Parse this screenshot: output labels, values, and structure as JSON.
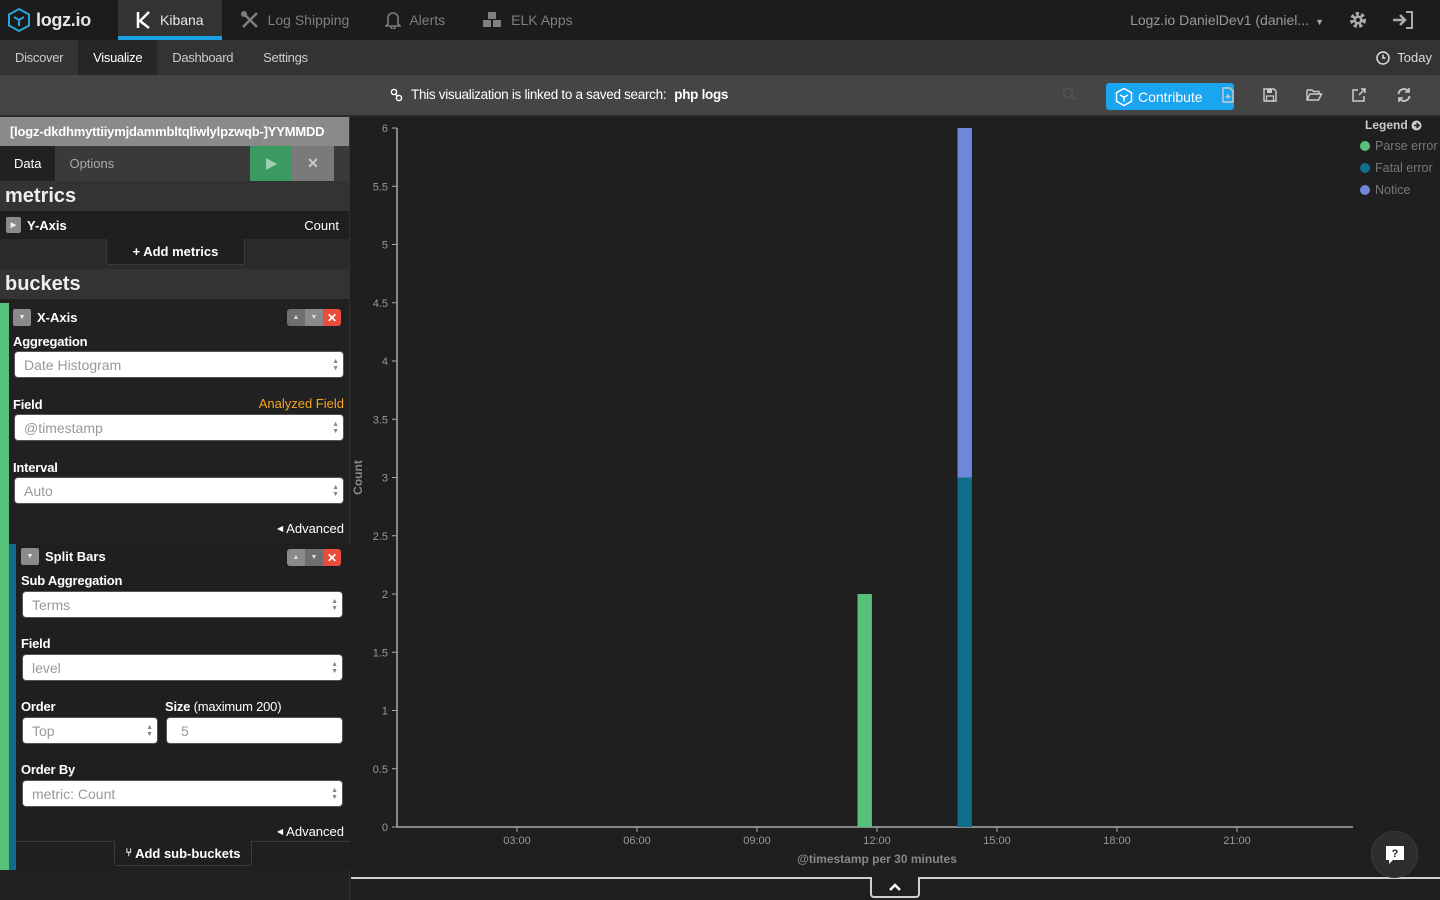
{
  "topbar": {
    "brand": "logz.io",
    "tabs": [
      {
        "label": "Kibana",
        "icon": "kibana-icon",
        "active": true
      },
      {
        "label": "Log Shipping",
        "icon": "tools-icon",
        "active": false
      },
      {
        "label": "Alerts",
        "icon": "bell-icon",
        "active": false
      },
      {
        "label": "ELK Apps",
        "icon": "cubes-icon",
        "active": false
      }
    ],
    "account": "Logz.io DanielDev1 (daniel...",
    "settings_icon": "gear-icon",
    "logout_icon": "sign-out-icon"
  },
  "subnav": {
    "items": [
      {
        "label": "Discover",
        "active": false
      },
      {
        "label": "Visualize",
        "active": true
      },
      {
        "label": "Dashboard",
        "active": false
      },
      {
        "label": "Settings",
        "active": false
      }
    ],
    "timepicker": "Today"
  },
  "toolbar": {
    "linked_prefix": "This visualization is linked to a saved search:",
    "linked_search": "php logs",
    "contribute_label": "Contribute",
    "actions": [
      "new-visualization",
      "save",
      "open",
      "share",
      "refresh"
    ]
  },
  "sidebar": {
    "index_pattern": "[logz-dkdhmyttiiymjdammbltqliwlylpzwqb-]YYMMDD",
    "tabs": [
      {
        "label": "Data",
        "active": true
      },
      {
        "label": "Options",
        "active": false
      }
    ],
    "metrics_title": "metrics",
    "metric": {
      "label": "Y-Axis",
      "value": "Count"
    },
    "add_metrics_label": "Add metrics",
    "buckets_title": "buckets",
    "x_axis": {
      "title": "X-Axis",
      "aggregation_label": "Aggregation",
      "aggregation_value": "Date Histogram",
      "field_label": "Field",
      "field_warning": "Analyzed Field",
      "field_value": "@timestamp",
      "interval_label": "Interval",
      "interval_value": "Auto",
      "advanced_label": "Advanced"
    },
    "split_bars": {
      "title": "Split Bars",
      "sub_aggregation_label": "Sub Aggregation",
      "sub_aggregation_value": "Terms",
      "field_label": "Field",
      "field_value": "level",
      "order_label": "Order",
      "order_value": "Top",
      "size_label": "Size",
      "size_hint": "(maximum 200)",
      "size_value": "5",
      "order_by_label": "Order By",
      "order_by_value": "metric: Count",
      "advanced_label": "Advanced"
    },
    "add_sub_buckets_label": "Add sub-buckets"
  },
  "legend": {
    "title": "Legend",
    "items": [
      {
        "label": "Parse error",
        "color": "#57c17b"
      },
      {
        "label": "Fatal error",
        "color": "#0f6e8a"
      },
      {
        "label": "Notice",
        "color": "#6f87d8"
      }
    ]
  },
  "chart_data": {
    "type": "bar",
    "stacked": true,
    "title": "",
    "xlabel": "@timestamp per 30 minutes",
    "ylabel": "Count",
    "ylim": [
      0,
      6
    ],
    "xlim_hours": [
      0,
      24
    ],
    "yticks": [
      "0",
      "0.5",
      "1",
      "1.5",
      "2",
      "2.5",
      "3",
      "3.5",
      "4",
      "4.5",
      "5",
      "5.5",
      "6"
    ],
    "xticks": [
      {
        "label": "03:00",
        "hour": 3
      },
      {
        "label": "06:00",
        "hour": 6
      },
      {
        "label": "09:00",
        "hour": 9
      },
      {
        "label": "12:00",
        "hour": 12
      },
      {
        "label": "15:00",
        "hour": 15
      },
      {
        "label": "18:00",
        "hour": 18
      },
      {
        "label": "21:00",
        "hour": 21
      }
    ],
    "bucket_minutes": 30,
    "categories": [
      "11:30",
      "14:00"
    ],
    "series": [
      {
        "name": "Parse error",
        "color": "#57c17b",
        "values": [
          2,
          0
        ],
        "start_hours": [
          11.5,
          14.0
        ]
      },
      {
        "name": "Fatal error",
        "color": "#0f6e8a",
        "values": [
          0,
          3
        ],
        "start_hours": [
          11.5,
          14.0
        ]
      },
      {
        "name": "Notice",
        "color": "#6f87d8",
        "values": [
          0,
          3
        ],
        "start_hours": [
          11.5,
          14.0
        ]
      }
    ],
    "legend_position": "top-right",
    "grid": false
  }
}
